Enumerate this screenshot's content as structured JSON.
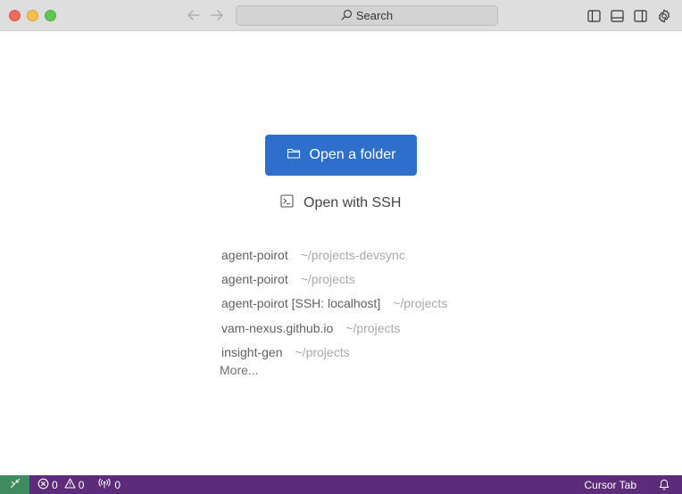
{
  "titlebar": {
    "search_label": "Search",
    "icons": [
      "back-arrow-icon",
      "forward-arrow-icon",
      "toggle-primary-sidebar-icon",
      "toggle-panel-icon",
      "toggle-secondary-sidebar-icon",
      "settings-gear-icon"
    ]
  },
  "main": {
    "open_folder_label": "Open a folder",
    "open_ssh_label": "Open with SSH",
    "recents": [
      {
        "name": "agent-poirot",
        "path": "~/projects-devsync"
      },
      {
        "name": "agent-poirot",
        "path": "~/projects"
      },
      {
        "name": "agent-poirot [SSH: localhost]",
        "path": "~/projects"
      },
      {
        "name": "vam-nexus.github.io",
        "path": "~/projects"
      },
      {
        "name": "insight-gen",
        "path": "~/projects"
      }
    ],
    "more_label": "More..."
  },
  "statusbar": {
    "errors_count": "0",
    "warnings_count": "0",
    "ports_count": "0",
    "cursor_tab_label": "Cursor Tab"
  },
  "colors": {
    "accent_button": "#2e6fcc",
    "statusbar_bg": "#5c2c7a",
    "remote_indicator_bg": "#3f8a5e"
  }
}
